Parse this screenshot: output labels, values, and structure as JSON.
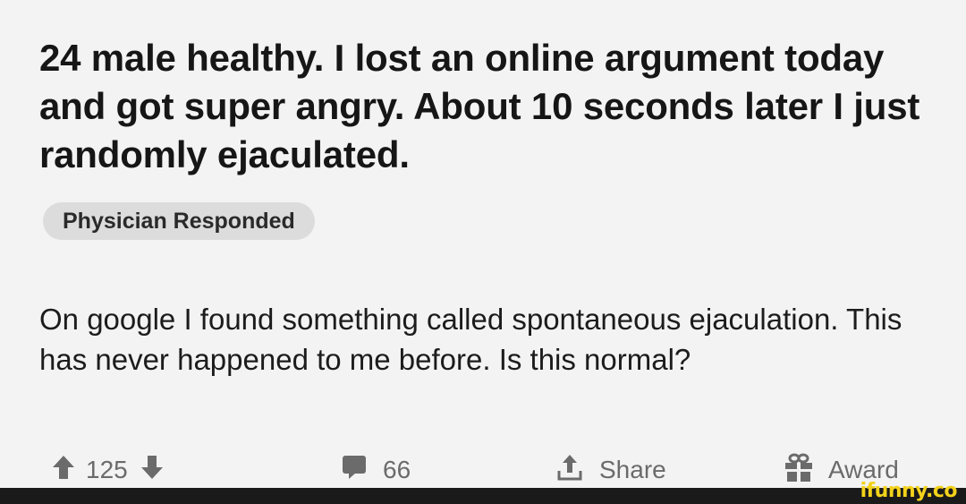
{
  "post": {
    "title": "24 male healthy. I lost an online argument today and got super angry. About 10 seconds later I just randomly ejaculated.",
    "flair": "Physician Responded",
    "body": "On google I found something called spontaneous ejaculation. This has never happened to me before. Is this normal?"
  },
  "actions": {
    "votes": "125",
    "comments": "66",
    "share": "Share",
    "award": "Award"
  },
  "icons": {
    "upvote": "arrow-up-icon",
    "downvote": "arrow-down-icon",
    "comments": "comment-icon",
    "share": "share-icon",
    "award": "gift-icon"
  },
  "watermark": "ifunny.co",
  "colors": {
    "background": "#f3f3f3",
    "flair_bg": "#dcdcdc",
    "action_text": "#6b6b6b",
    "watermark": "#f2d21b"
  }
}
